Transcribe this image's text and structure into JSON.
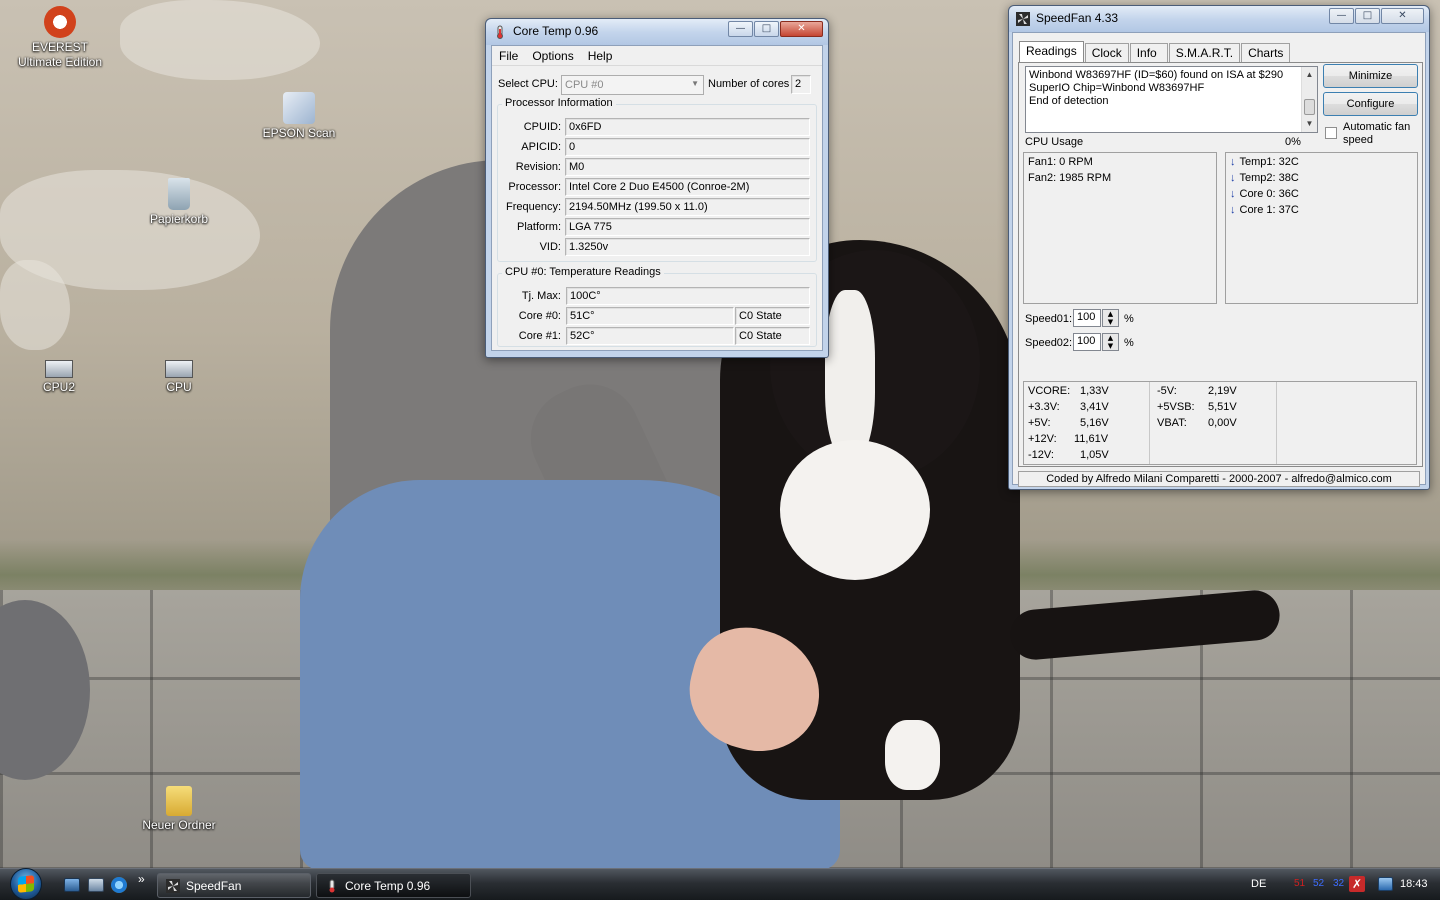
{
  "desktop": {
    "icons": [
      {
        "label": "EVEREST Ultimate Edition",
        "icon": "everest-icon"
      },
      {
        "label": "EPSON Scan",
        "icon": "scanner-icon"
      },
      {
        "label": "Papierkorb",
        "icon": "recycle-bin-icon"
      },
      {
        "label": "CPU2",
        "icon": "screenshot-file-icon"
      },
      {
        "label": "CPU",
        "icon": "screenshot-file-icon"
      },
      {
        "label": "Neuer Ordner",
        "icon": "folder-icon"
      }
    ]
  },
  "coretemp": {
    "title": "Core Temp 0.96",
    "menu": [
      "File",
      "Options",
      "Help"
    ],
    "select_cpu_label": "Select CPU:",
    "select_cpu_value": "CPU #0",
    "num_cores_label": "Number of cores",
    "num_cores_value": "2",
    "proc_group_title": "Processor Information",
    "proc_info": [
      {
        "label": "CPUID:",
        "value": "0x6FD"
      },
      {
        "label": "APICID:",
        "value": "0"
      },
      {
        "label": "Revision:",
        "value": "M0"
      },
      {
        "label": "Processor:",
        "value": "Intel Core 2 Duo E4500 (Conroe-2M)"
      },
      {
        "label": "Frequency:",
        "value": "2194.50MHz (199.50 x 11.0)"
      },
      {
        "label": "Platform:",
        "value": "LGA 775"
      },
      {
        "label": "VID:",
        "value": "1.3250v"
      }
    ],
    "temp_group_title": "CPU #0: Temperature Readings",
    "tjmax_label": "Tj. Max:",
    "tjmax_value": "100C°",
    "cores": [
      {
        "label": "Core #0:",
        "temp": "51C°",
        "state": "C0 State"
      },
      {
        "label": "Core #1:",
        "temp": "52C°",
        "state": "C0 State"
      }
    ]
  },
  "speedfan": {
    "title": "SpeedFan 4.33",
    "tabs": [
      "Readings",
      "Clock",
      "Info",
      "S.M.A.R.T.",
      "Charts"
    ],
    "log_lines": [
      "Winbond W83697HF (ID=$60) found on ISA at $290",
      "SuperIO Chip=Winbond W83697HF",
      "End of detection"
    ],
    "minimize_label": "Minimize",
    "configure_label": "Configure",
    "auto_fan_label": "Automatic fan speed",
    "cpu_usage_label": "CPU Usage",
    "cpu_usage_value": "0%",
    "fans": [
      "Fan1: 0 RPM",
      "Fan2: 1985 RPM"
    ],
    "temps": [
      "Temp1: 32C",
      "Temp2: 38C",
      "Core 0: 36C",
      "Core 1: 37C"
    ],
    "speeds": [
      {
        "label": "Speed01:",
        "value": "100",
        "unit": "%"
      },
      {
        "label": "Speed02:",
        "value": "100",
        "unit": "%"
      }
    ],
    "voltages_left": [
      {
        "label": "VCORE:",
        "value": "1,33V"
      },
      {
        "label": "+3.3V:",
        "value": "3,41V"
      },
      {
        "label": "+5V:",
        "value": "5,16V"
      },
      {
        "label": "+12V:",
        "value": "11,61V"
      },
      {
        "label": "-12V:",
        "value": "1,05V"
      }
    ],
    "voltages_right": [
      {
        "label": "-5V:",
        "value": "2,19V"
      },
      {
        "label": "+5VSB:",
        "value": "5,51V"
      },
      {
        "label": "VBAT:",
        "value": "0,00V"
      }
    ],
    "credit": "Coded by Alfredo Milani Comparetti - 2000-2007 - alfredo@almico.com"
  },
  "taskbar": {
    "buttons": [
      {
        "label": "SpeedFan"
      },
      {
        "label": "Core Temp 0.96"
      }
    ],
    "quicklaunch_more": "»",
    "language": "DE",
    "tray_temps": [
      "51",
      "52",
      "32"
    ],
    "clock": "18:43"
  },
  "colors": {
    "accent": "#3c7fb1",
    "temp_red": "#c00000",
    "temp_blue": "#1b3ea6"
  }
}
